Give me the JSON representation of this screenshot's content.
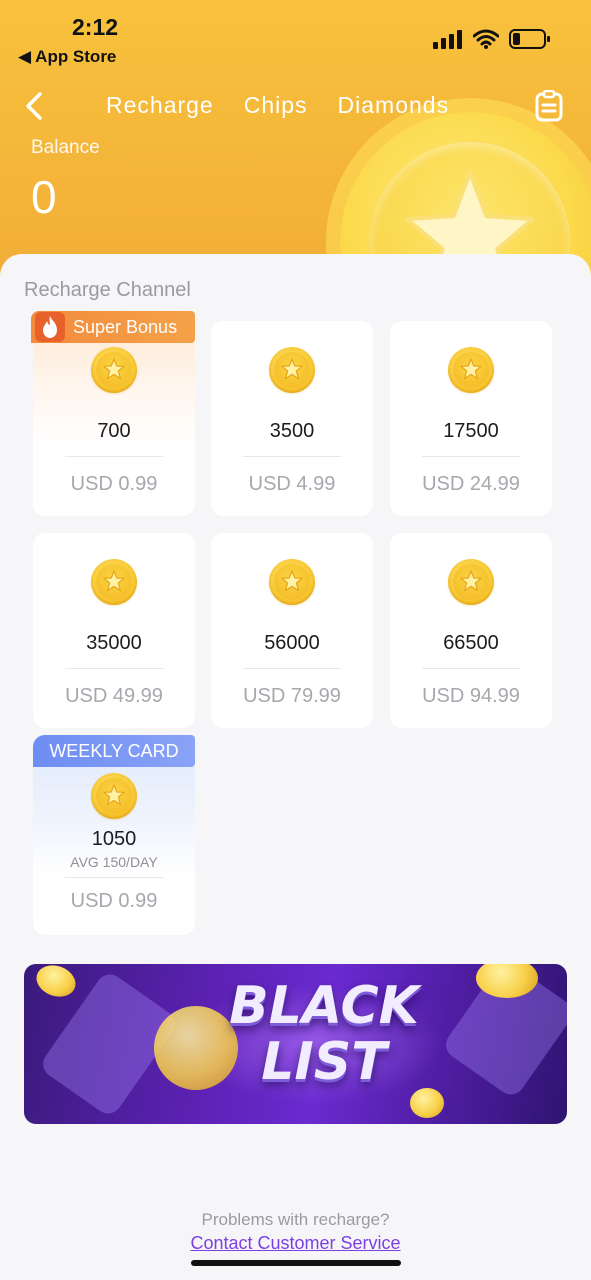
{
  "status_bar": {
    "time": "2:12",
    "back_app": "◀ App Store"
  },
  "nav": {
    "tabs": [
      {
        "label": "Recharge"
      },
      {
        "label": "Chips"
      },
      {
        "label": "Diamonds"
      }
    ]
  },
  "balance": {
    "label": "Balance",
    "value": "0"
  },
  "section_title": "Recharge Channel",
  "packages": [
    {
      "badge": "Super Bonus",
      "amount": "700",
      "price": "USD 0.99"
    },
    {
      "amount": "3500",
      "price": "USD 4.99"
    },
    {
      "amount": "17500",
      "price": "USD 24.99"
    },
    {
      "amount": "35000",
      "price": "USD 49.99"
    },
    {
      "amount": "56000",
      "price": "USD 79.99"
    },
    {
      "amount": "66500",
      "price": "USD 94.99"
    }
  ],
  "weekly_card": {
    "badge": "WEEKLY CARD",
    "amount": "1050",
    "avg": "AVG 150/DAY",
    "price": "USD 0.99"
  },
  "banner": {
    "line1": "BLACK",
    "line2": "LIST"
  },
  "footer": {
    "help_text": "Problems with recharge?",
    "contact_link": "Contact Customer Service"
  },
  "colors": {
    "header": "#f5b83a",
    "accent_link": "#7b3fe4",
    "bonus_badge": "#f28b3c",
    "weekly_badge": "#6d8df2"
  }
}
